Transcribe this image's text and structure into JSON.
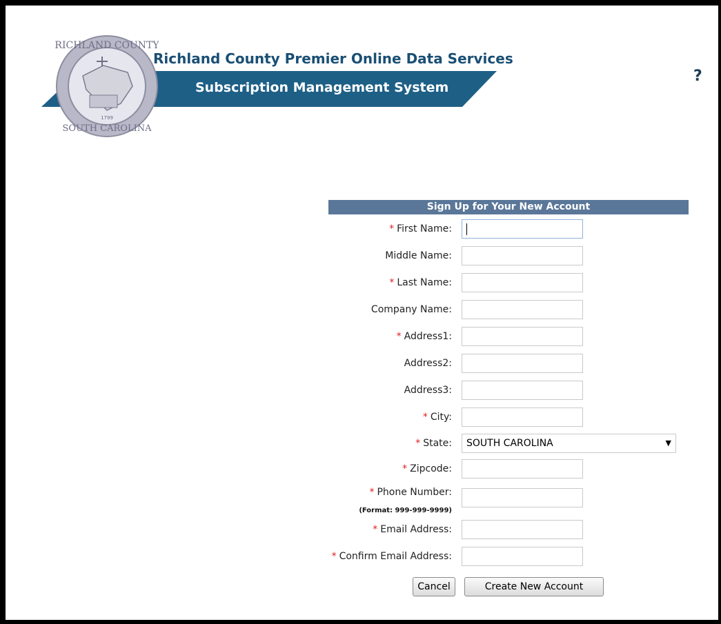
{
  "header": {
    "title": "Richland County Premier Online Data Services",
    "subtitle": "Subscription Management System",
    "seal_text": "RICHLAND COUNTY · SOUTH CAROLINA · 1799",
    "help_label": "?"
  },
  "form": {
    "heading": "Sign Up for Your New Account",
    "required_mark": "*",
    "fields": {
      "first_name": {
        "label": "First Name:",
        "value": ""
      },
      "middle_name": {
        "label": "Middle Name:",
        "value": ""
      },
      "last_name": {
        "label": "Last Name:",
        "value": ""
      },
      "company_name": {
        "label": "Company Name:",
        "value": ""
      },
      "address1": {
        "label": "Address1:",
        "value": ""
      },
      "address2": {
        "label": "Address2:",
        "value": ""
      },
      "address3": {
        "label": "Address3:",
        "value": ""
      },
      "city": {
        "label": "City:",
        "value": ""
      },
      "state": {
        "label": "State:",
        "value": "SOUTH CAROLINA"
      },
      "zipcode": {
        "label": "Zipcode:",
        "value": ""
      },
      "phone": {
        "label": "Phone Number:",
        "value": "",
        "hint": "(Format: 999-999-9999)"
      },
      "email": {
        "label": "Email Address:",
        "value": ""
      },
      "confirm_email": {
        "label": "Confirm Email Address:",
        "value": ""
      }
    },
    "buttons": {
      "cancel": "Cancel",
      "create": "Create New Account"
    }
  },
  "colors": {
    "brand": "#1a4f74",
    "banner": "#1e5f86",
    "header_bar": "#5a7799",
    "required": "#e02020"
  }
}
